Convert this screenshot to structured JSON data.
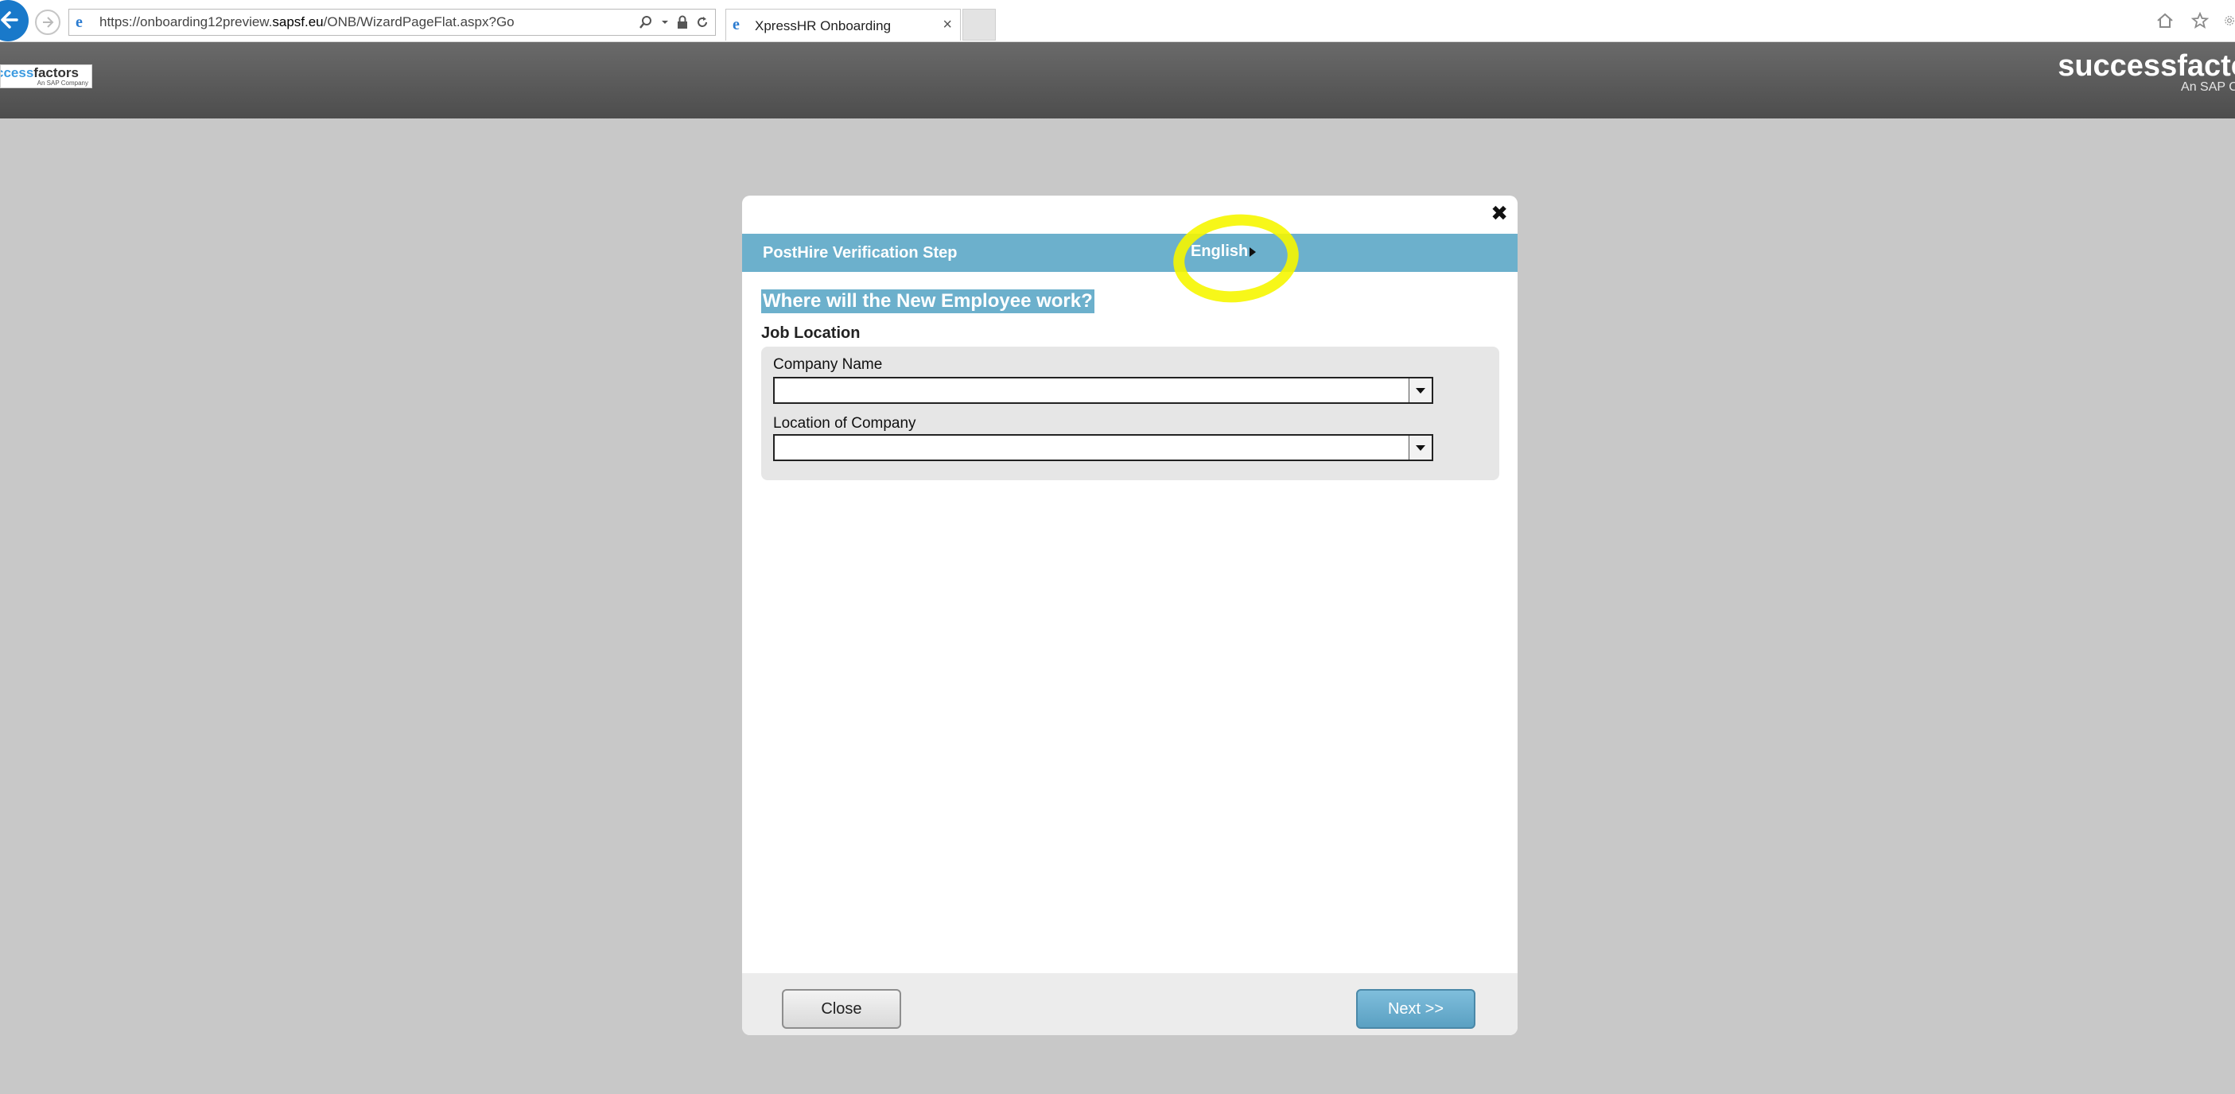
{
  "browser": {
    "url_prefix": "https://onboarding12preview.",
    "url_domain": "sapsf.eu",
    "url_path": "/ONB/WizardPageFlat.aspx?Go",
    "tab_title": "XpressHR Onboarding",
    "tab_close": "×"
  },
  "header": {
    "logo_small_a": "ccess",
    "logo_small_b": "factors",
    "logo_small_tag": "An SAP Company",
    "brand": "successfacto",
    "brand_sub": "An SAP Cor"
  },
  "modal": {
    "close_symbol": "✖",
    "step_title": "PostHire Verification Step",
    "language": "English",
    "question": "Where will the New Employee work?",
    "section_title": "Job Location",
    "fields": [
      {
        "label": "Company Name",
        "value": ""
      },
      {
        "label": "Location of Company",
        "value": ""
      }
    ],
    "close_label": "Close",
    "next_label": "Next >>"
  },
  "colors": {
    "accent": "#6cb0cc",
    "header_bg": "#5a5a5a",
    "highlight": "#f6f600",
    "page_bg": "#c8c8c8"
  }
}
